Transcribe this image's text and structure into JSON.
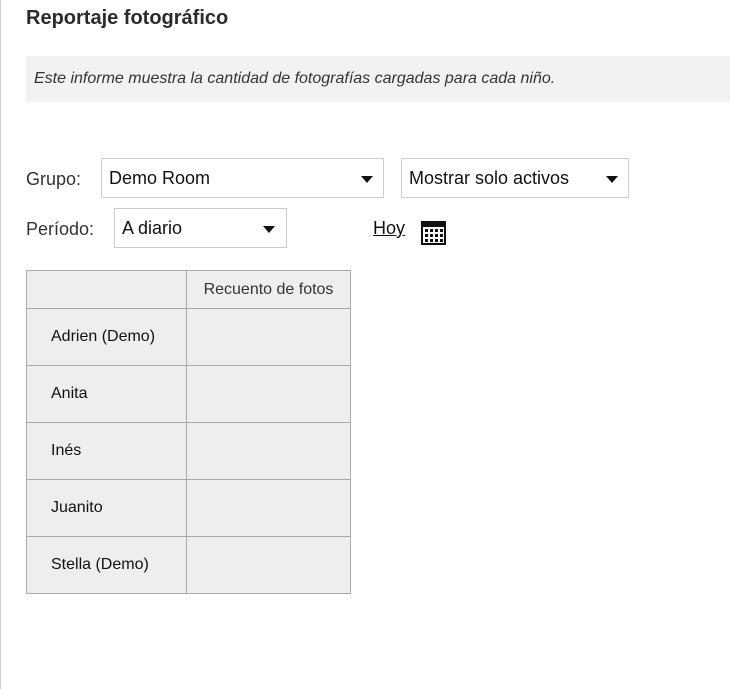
{
  "page": {
    "title": "Reportaje fotográfico",
    "description": "Este informe muestra la cantidad de fotografías cargadas para cada niño."
  },
  "filters": {
    "group_label": "Grupo:",
    "group_value": "Demo Room",
    "status_value": "Mostrar solo activos",
    "period_label": "Período:",
    "period_value": "A diario",
    "today_link": "Hoy"
  },
  "table": {
    "headers": [
      "",
      "Recuento de fotos"
    ],
    "rows": [
      {
        "name": "Adrien (Demo)",
        "count": ""
      },
      {
        "name": "Anita",
        "count": ""
      },
      {
        "name": "Inés",
        "count": ""
      },
      {
        "name": "Juanito",
        "count": ""
      },
      {
        "name": "Stella (Demo)",
        "count": ""
      }
    ]
  }
}
